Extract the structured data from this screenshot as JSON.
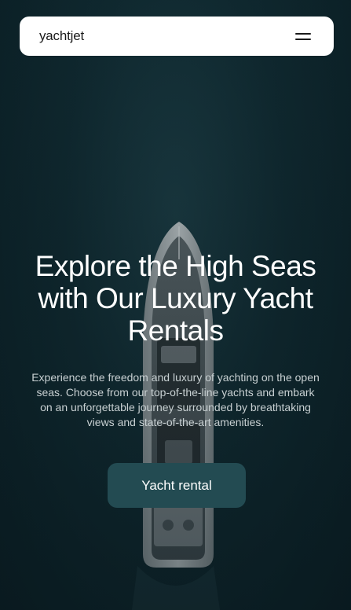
{
  "navbar": {
    "logo": "yachtjet",
    "menu_icon": "hamburger-menu-icon"
  },
  "hero": {
    "title": "Explore the High Seas with Our Luxury Yacht Rentals",
    "description": "Experience the freedom and luxury of yachting on the open seas. Choose from our top-of-the-line yachts and embark on an unforgettable journey surrounded by breathtaking views and state-of-the-art amenities.",
    "cta_label": "Yacht rental"
  },
  "colors": {
    "water": "#102a31",
    "cta_background": "#234b52",
    "navbar_background": "#ffffff",
    "title_text": "#ffffff",
    "body_text": "#c8d0d2"
  }
}
